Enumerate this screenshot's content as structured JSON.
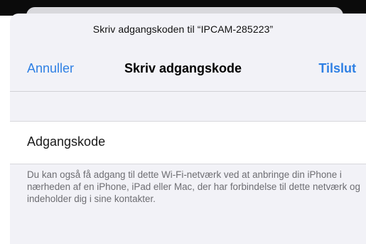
{
  "dialog": {
    "prompt": "Skriv adgangskoden til “IPCAM-285223”",
    "title": "Skriv adgangskode",
    "cancel_label": "Annuller",
    "join_label": "Tilslut"
  },
  "password_field": {
    "placeholder": "Adgangskode",
    "value": ""
  },
  "footnote": "Du kan også få adgang til dette Wi-Fi-netværk ved at anbringe din iPhone i nærheden af en iPhone, iPad eller Mac, der har forbindelse til dette netværk og indeholder dig i sine kontakter.",
  "colors": {
    "accent": "#2f80e4",
    "sheet_background": "#f2f2f7",
    "secondary_text": "#6d6d72"
  }
}
